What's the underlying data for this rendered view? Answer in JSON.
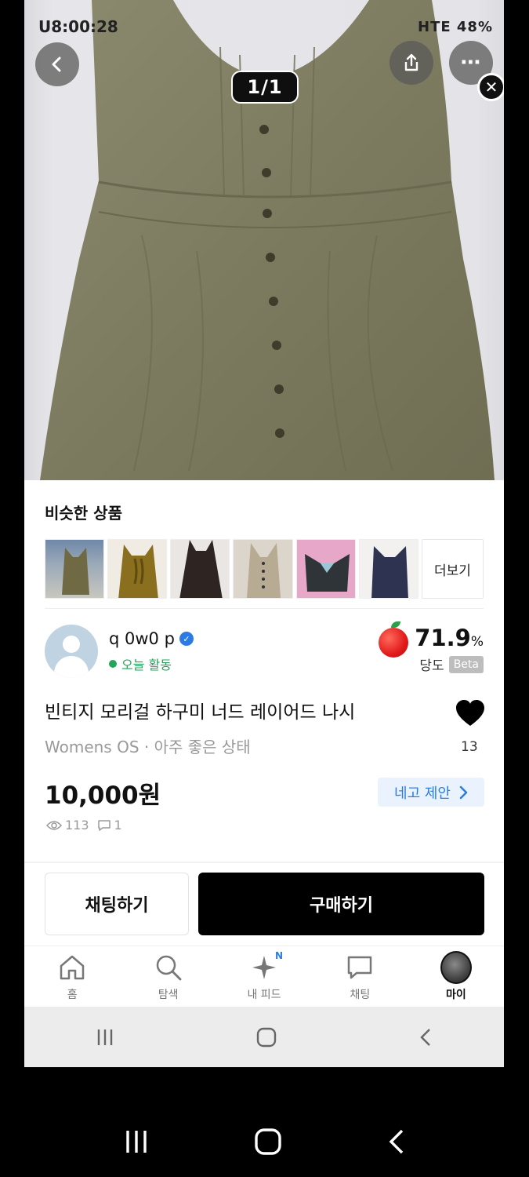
{
  "status_bar": {
    "time": "U8:00:28",
    "right": "HTE 48%"
  },
  "viewer": {
    "pager": "1/1"
  },
  "similar": {
    "title": "비슷한 상품",
    "more_label": "더보기",
    "thumbnails": [
      {
        "icon": "vest-khaki"
      },
      {
        "icon": "ruffle-top-olive"
      },
      {
        "icon": "dress-brown"
      },
      {
        "icon": "vest-beige"
      },
      {
        "icon": "vest-dark-denim"
      },
      {
        "icon": "vest-navy"
      }
    ]
  },
  "seller": {
    "name": "q 0w0 p",
    "activity": "오늘 활동",
    "score": "71.9",
    "score_unit": "%",
    "score_label": "당도",
    "beta": "Beta"
  },
  "product": {
    "title": "빈티지 모리걸 하구미 너드 레이어드 나시",
    "subtitle": "Womens OS · 아주 좋은 상태",
    "likes": "13",
    "price": "10,000원",
    "offer_label": "네고 제안",
    "views": "113",
    "comments": "1"
  },
  "actions": {
    "chat": "채팅하기",
    "buy": "구매하기"
  },
  "tabs": [
    {
      "label": "홈",
      "icon": "home-icon"
    },
    {
      "label": "탐색",
      "icon": "search-icon"
    },
    {
      "label": "내 피드",
      "icon": "sparkle-icon",
      "badge": "N"
    },
    {
      "label": "채팅",
      "icon": "chat-icon"
    },
    {
      "label": "마이",
      "icon": "avatar-icon"
    }
  ],
  "colors": {
    "accent_blue": "#2a7de1",
    "active_green": "#23a65a",
    "buy_black": "#000000",
    "offer_bg": "#eaf3fd"
  }
}
